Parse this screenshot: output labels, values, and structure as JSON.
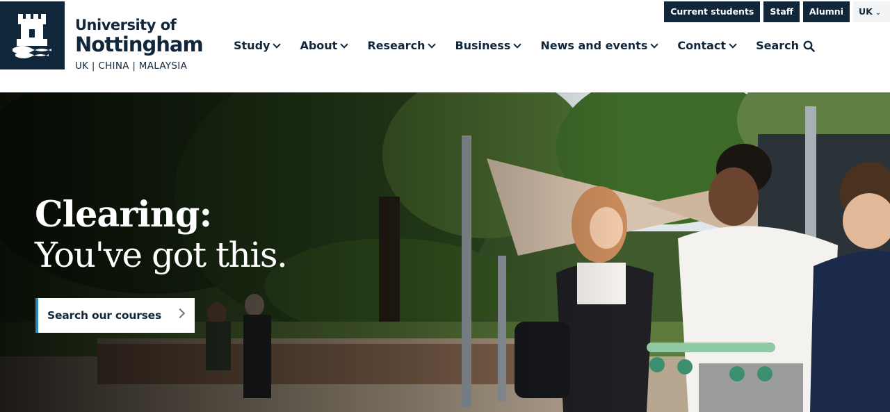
{
  "logo": {
    "line1": "University of",
    "line2": "Nottingham",
    "line3": "UK | CHINA | MALAYSIA"
  },
  "utility_nav": {
    "current_students": "Current students",
    "staff": "Staff",
    "alumni": "Alumni",
    "region": "UK"
  },
  "main_nav": {
    "items": [
      {
        "label": "Study"
      },
      {
        "label": "About"
      },
      {
        "label": "Research"
      },
      {
        "label": "Business"
      },
      {
        "label": "News and events"
      },
      {
        "label": "Contact"
      }
    ],
    "search_label": "Search"
  },
  "hero": {
    "title_line1": "Clearing:",
    "title_line2": "You've got this.",
    "cta_label": "Search our courses"
  },
  "icons": {
    "logo": "castle-crest-icon",
    "search": "search-icon",
    "chevron": "chevron-down-icon",
    "cta_arrow": "chevron-right-icon"
  },
  "colors": {
    "brand_navy": "#10263b",
    "cta_accent": "#2a8bb8"
  }
}
